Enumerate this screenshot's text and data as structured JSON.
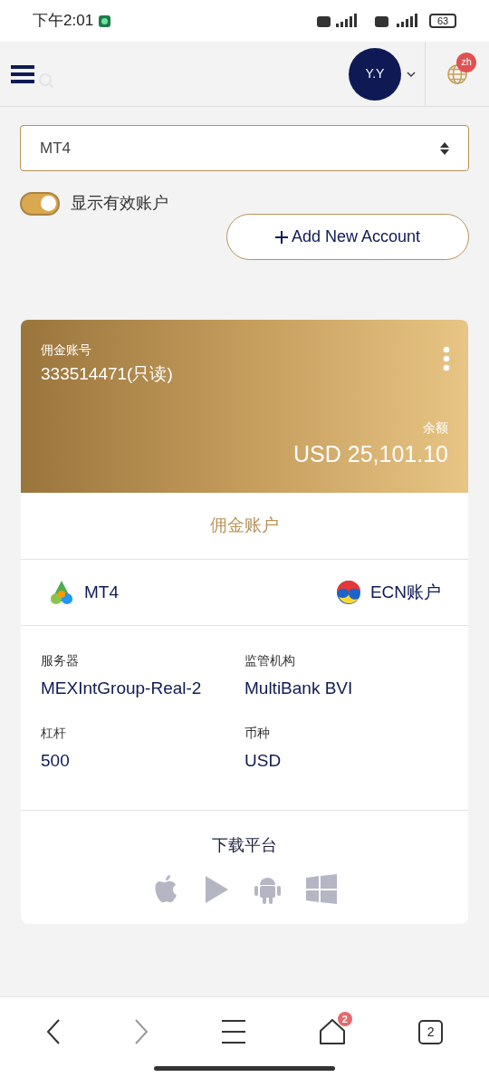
{
  "status_bar": {
    "time": "下午2:01",
    "battery": "63"
  },
  "header": {
    "avatar": "Y.Y",
    "language_badge": "zh"
  },
  "platform_select": {
    "value": "MT4"
  },
  "active_toggle": {
    "label": "显示有效账户",
    "on": true
  },
  "add_account_button": {
    "label": "Add New Account"
  },
  "account_card": {
    "account_label": "佣金账号",
    "account_number": "333514471(只读)",
    "balance_label": "余额",
    "balance": "USD 25,101.10",
    "account_category": "佣金账户",
    "platform": "MT4",
    "account_type": "ECN账户",
    "details": [
      {
        "label": "服务器",
        "value": "MEXIntGroup-Real-2"
      },
      {
        "label": "监管机构",
        "value": "MultiBank BVI"
      },
      {
        "label": "杠杆",
        "value": "500"
      },
      {
        "label": "币种",
        "value": "USD"
      }
    ],
    "download_title": "下载平台"
  },
  "browser_bar": {
    "home_badge": "2",
    "tab_count": "2"
  }
}
